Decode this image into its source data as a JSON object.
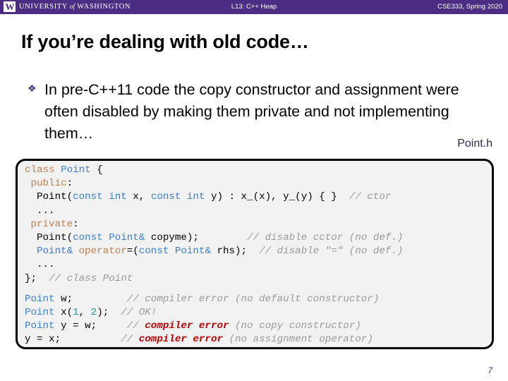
{
  "header": {
    "logo_letter": "W",
    "university_pre": "UNIVERSITY",
    "university_of": "of",
    "university_post": "WASHINGTON",
    "center_title": "L13: C++ Heap",
    "right_title": "CSE333, Spring 2020",
    "bar_color": "#4b2e83"
  },
  "slide": {
    "title": "If you’re dealing with old code…",
    "bullet_glyph": "❖",
    "bullet_text": "In pre-C++11 code the copy constructor and assignment were often disabled by making them private and not implementing them…",
    "file_label": "Point.h",
    "page_number": "7"
  },
  "code": {
    "language": "cpp",
    "lines": [
      [
        {
          "t": "class ",
          "c": "kw"
        },
        {
          "t": "Point ",
          "c": "typ"
        },
        {
          "t": "{",
          "c": "plain"
        }
      ],
      [
        {
          "t": " public",
          "c": "kw"
        },
        {
          "t": ":",
          "c": "plain"
        }
      ],
      [
        {
          "t": "  Point(",
          "c": "plain"
        },
        {
          "t": "const ",
          "c": "typ"
        },
        {
          "t": "int ",
          "c": "typ"
        },
        {
          "t": "x, ",
          "c": "plain"
        },
        {
          "t": "const ",
          "c": "typ"
        },
        {
          "t": "int ",
          "c": "typ"
        },
        {
          "t": "y) : x_(x), y_(y) { }  ",
          "c": "plain"
        },
        {
          "t": "// ctor",
          "c": "cmt"
        }
      ],
      [
        {
          "t": "  ...",
          "c": "plain"
        }
      ],
      [
        {
          "t": " private",
          "c": "kw"
        },
        {
          "t": ":",
          "c": "plain"
        }
      ],
      [
        {
          "t": "  Point(",
          "c": "plain"
        },
        {
          "t": "const ",
          "c": "typ"
        },
        {
          "t": "Point&",
          "c": "typ"
        },
        {
          "t": " copyme);        ",
          "c": "plain"
        },
        {
          "t": "// disable cctor (no def.)",
          "c": "cmt"
        }
      ],
      [
        {
          "t": "  Point&",
          "c": "typ"
        },
        {
          "t": " operator",
          "c": "kw"
        },
        {
          "t": "=(",
          "c": "plain"
        },
        {
          "t": "const ",
          "c": "typ"
        },
        {
          "t": "Point&",
          "c": "typ"
        },
        {
          "t": " rhs);  ",
          "c": "plain"
        },
        {
          "t": "// disable \"=\" (no def.)",
          "c": "cmt"
        }
      ],
      [
        {
          "t": "  ...",
          "c": "plain"
        }
      ],
      [
        {
          "t": "};  ",
          "c": "plain"
        },
        {
          "t": "// class Point",
          "c": "cmt"
        }
      ],
      [
        {
          "t": "",
          "c": "blank"
        }
      ],
      [
        {
          "t": "Point",
          "c": "typ"
        },
        {
          "t": " w;         ",
          "c": "plain"
        },
        {
          "t": "// compiler error (no default constructor)",
          "c": "cmt"
        }
      ],
      [
        {
          "t": "Point",
          "c": "typ"
        },
        {
          "t": " x(",
          "c": "plain"
        },
        {
          "t": "1",
          "c": "num"
        },
        {
          "t": ", ",
          "c": "plain"
        },
        {
          "t": "2",
          "c": "num"
        },
        {
          "t": ");  ",
          "c": "plain"
        },
        {
          "t": "// OK!",
          "c": "cmt"
        }
      ],
      [
        {
          "t": "Point",
          "c": "typ"
        },
        {
          "t": " y = w;     ",
          "c": "plain"
        },
        {
          "t": "// ",
          "c": "cmt"
        },
        {
          "t": "compiler error",
          "c": "err"
        },
        {
          "t": " (no copy constructor)",
          "c": "cmt"
        }
      ],
      [
        {
          "t": "y = x;        ",
          "c": "plain"
        },
        {
          "t": "  // ",
          "c": "cmt"
        },
        {
          "t": "compiler error",
          "c": "err"
        },
        {
          "t": " (no assignment operator)",
          "c": "cmt"
        }
      ]
    ]
  }
}
